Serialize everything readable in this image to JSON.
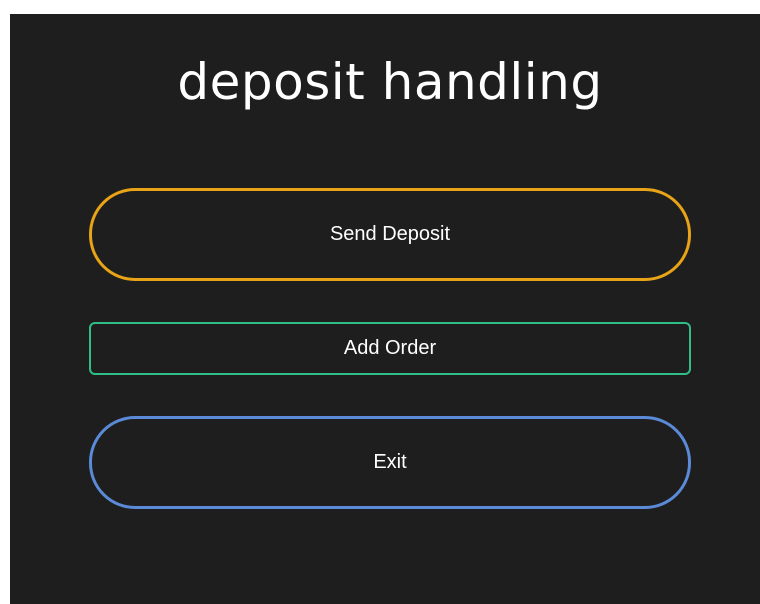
{
  "title": "deposit handling",
  "buttons": {
    "send_deposit": "Send Deposit",
    "add_order": "Add Order",
    "exit": "Exit"
  },
  "colors": {
    "background": "#1e1e1e",
    "send_deposit_border": "#e8a317",
    "add_order_border": "#2fbf86",
    "exit_border": "#5b8bd8",
    "text": "#ffffff"
  }
}
